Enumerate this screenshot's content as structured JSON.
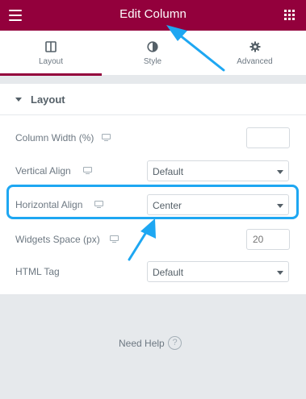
{
  "header": {
    "title": "Edit Column",
    "menu_icon": "hamburger-menu-icon",
    "apps_icon": "apps-grid-icon",
    "bg_color": "#93003c"
  },
  "tabs": [
    {
      "label": "Layout",
      "icon": "columns-icon",
      "active": true
    },
    {
      "label": "Style",
      "icon": "half-circle-icon",
      "active": false
    },
    {
      "label": "Advanced",
      "icon": "gear-icon",
      "active": false
    }
  ],
  "section": {
    "title": "Layout",
    "rows": [
      {
        "label": "Column Width (%)",
        "control": "text",
        "value": "",
        "placeholder": ""
      },
      {
        "label": "Vertical Align",
        "control": "select",
        "value": "Default"
      },
      {
        "label": "Horizontal Align",
        "control": "select",
        "value": "Center",
        "highlighted": true
      },
      {
        "label": "Widgets Space (px)",
        "control": "text",
        "value": "",
        "placeholder": "20"
      },
      {
        "label": "HTML Tag",
        "control": "select",
        "value": "Default"
      }
    ]
  },
  "help": {
    "label": "Need Help",
    "icon": "question-circle-icon"
  },
  "colors": {
    "accent": "#93003c",
    "highlight": "#1ea7f2"
  }
}
